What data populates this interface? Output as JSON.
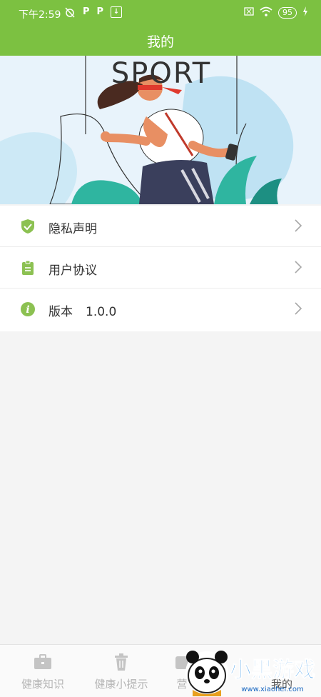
{
  "status_bar": {
    "time": "下午2:59",
    "icons": [
      "alarm-off-icon",
      "p-notification-icon",
      "p-notification-icon",
      "download-icon"
    ],
    "battery": "95",
    "right_icons": [
      "sim-off-icon",
      "wifi-icon",
      "charging-icon"
    ]
  },
  "header": {
    "title": "我的"
  },
  "banner": {
    "text": "SPORT"
  },
  "menu": {
    "items": [
      {
        "label": "隐私声明",
        "value": "",
        "icon": "shield-check-icon"
      },
      {
        "label": "用户协议",
        "value": "",
        "icon": "clipboard-icon"
      },
      {
        "label": "版本",
        "value": "1.0.0",
        "icon": "info-icon"
      }
    ]
  },
  "tabbar": {
    "items": [
      {
        "label": "健康知识",
        "icon": "briefcase-icon"
      },
      {
        "label": "健康小提示",
        "icon": "trash-icon"
      },
      {
        "label": "营",
        "icon": "tab-icon"
      },
      {
        "label": "我的",
        "icon": "profile-icon"
      }
    ]
  },
  "watermark": {
    "text": "小黑游戏",
    "url": "www.xiaohei.com"
  },
  "colors": {
    "primary": "#7cc141",
    "icon_green": "#8cc152",
    "tab_inactive": "#b5b5b5",
    "chevron": "#a8a8a8"
  }
}
